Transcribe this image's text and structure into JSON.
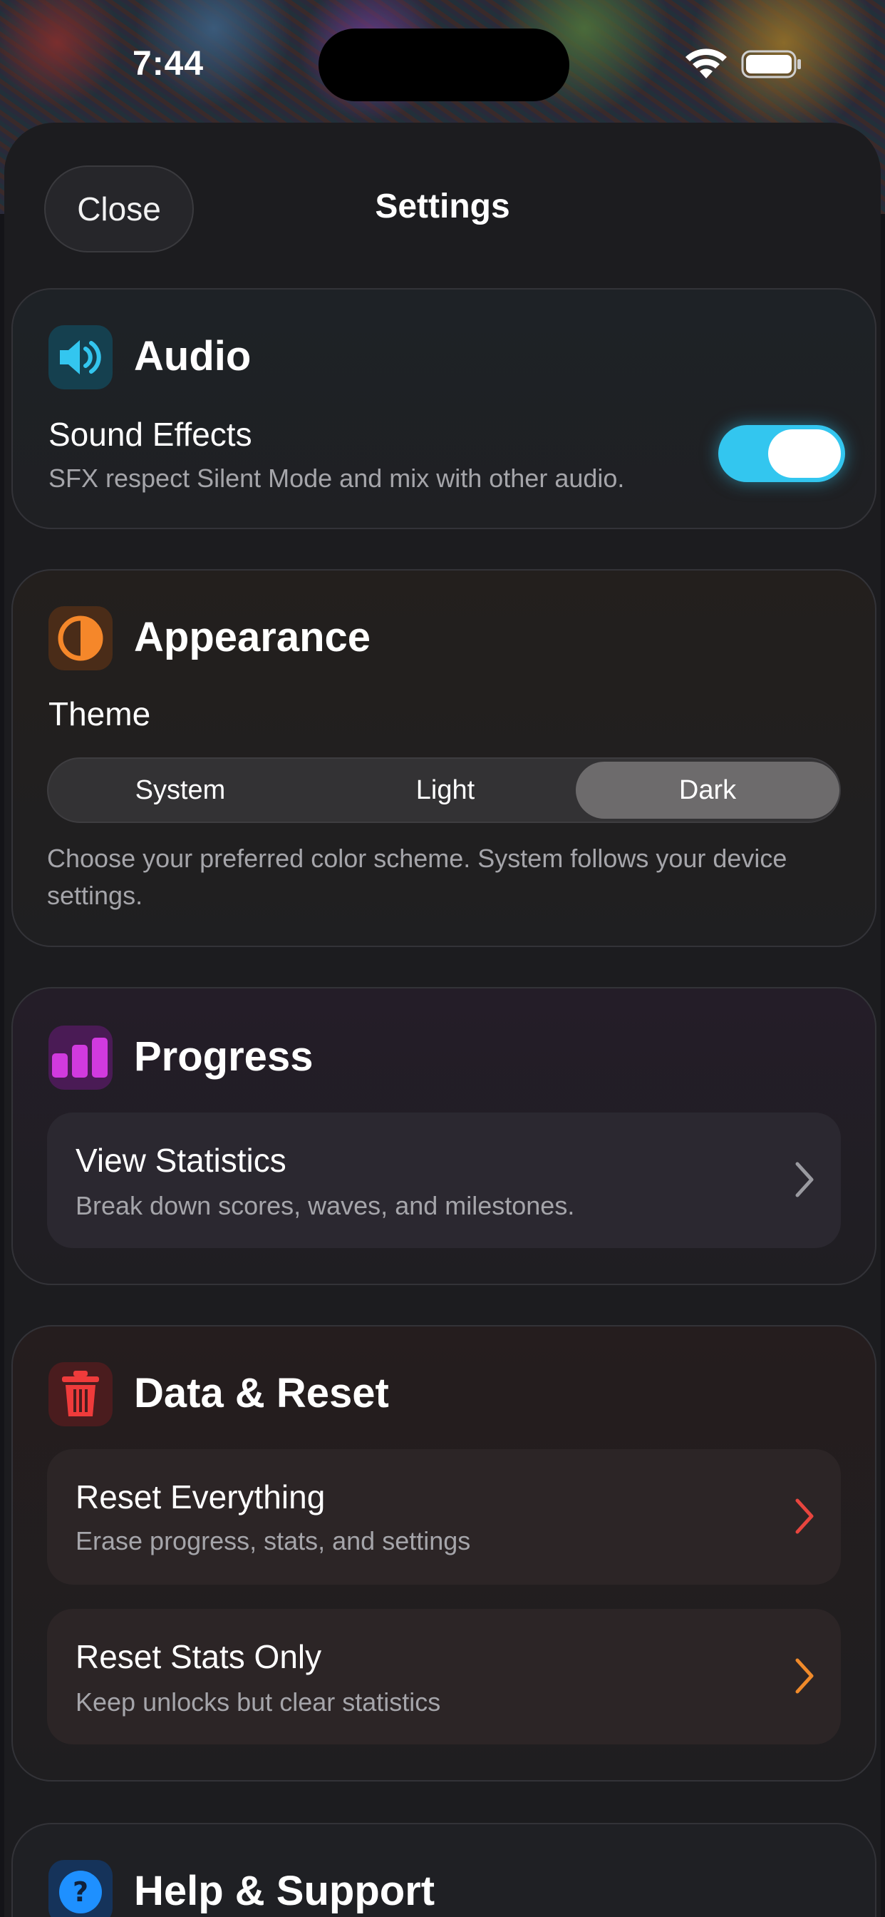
{
  "status_bar": {
    "time": "7:44"
  },
  "header": {
    "close_label": "Close",
    "title": "Settings"
  },
  "audio": {
    "title": "Audio",
    "sound_effects_label": "Sound Effects",
    "sound_effects_description": "SFX respect Silent Mode and mix with other audio.",
    "sound_effects_enabled": true,
    "icon": "speaker-icon",
    "accent": "#33c6ef"
  },
  "appearance": {
    "title": "Appearance",
    "theme_label": "Theme",
    "options": [
      "System",
      "Light",
      "Dark"
    ],
    "selected": "Dark",
    "description": "Choose your preferred color scheme. System follows your device settings.",
    "icon": "half-circle-icon",
    "accent": "#f5872a"
  },
  "progress": {
    "title": "Progress",
    "icon": "bar-chart-icon",
    "accent": "#d13adf",
    "view_statistics": {
      "label": "View Statistics",
      "description": "Break down scores, waves, and milestones."
    }
  },
  "data_reset": {
    "title": "Data & Reset",
    "icon": "trash-icon",
    "accent": "#ef3b3b",
    "reset_everything": {
      "label": "Reset Everything",
      "description": "Erase progress, stats, and settings"
    },
    "reset_stats": {
      "label": "Reset Stats Only",
      "description": "Keep unlocks but clear statistics"
    }
  },
  "help": {
    "title": "Help & Support",
    "icon": "question-icon",
    "accent": "#1e90ff"
  }
}
